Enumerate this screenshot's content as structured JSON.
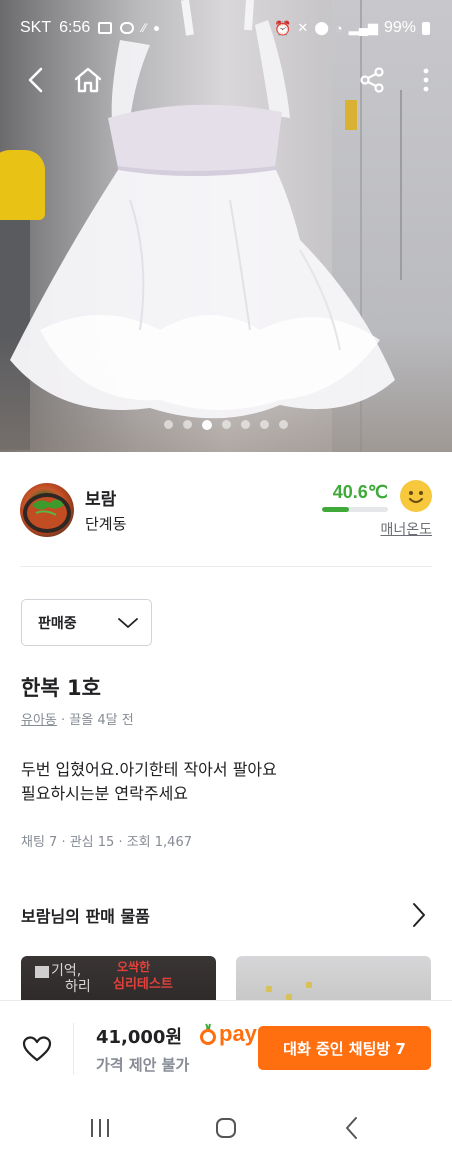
{
  "status_bar": {
    "carrier": "SKT",
    "time": "6:56",
    "battery": "99%"
  },
  "gallery": {
    "page_count": 7,
    "active_index": 2
  },
  "seller": {
    "name": "보람",
    "location": "단계동",
    "manner_temp": "40.6℃",
    "manner_temp_value": 40.6,
    "manner_label": "매너온도"
  },
  "sale_status": {
    "selected": "판매중"
  },
  "post": {
    "title": "한복 1호",
    "category": "유아동",
    "time_ago": "· 끌올 4달 전",
    "description_line1": "두번 입혔어요.아기한테 작아서 팔아요",
    "description_line2": "필요하시는분 연락주세요",
    "stats": "채팅 7 · 관심 15 · 조회 1,467"
  },
  "more_items": {
    "title": "보람님의 판매 물품",
    "card1_text1": "기억,",
    "card1_text2": "하리",
    "card1_text3": "오싹한",
    "card1_text4": "심리테스트"
  },
  "bottom_bar": {
    "price": "41,000원",
    "pay_label": "pay",
    "negotiation": "가격 제안 불가",
    "chat_button": "대화 중인 채팅방 7"
  },
  "colors": {
    "brand_orange": "#ff6f0f",
    "temp_green": "#3faa3a",
    "muted_text": "#868b94"
  }
}
